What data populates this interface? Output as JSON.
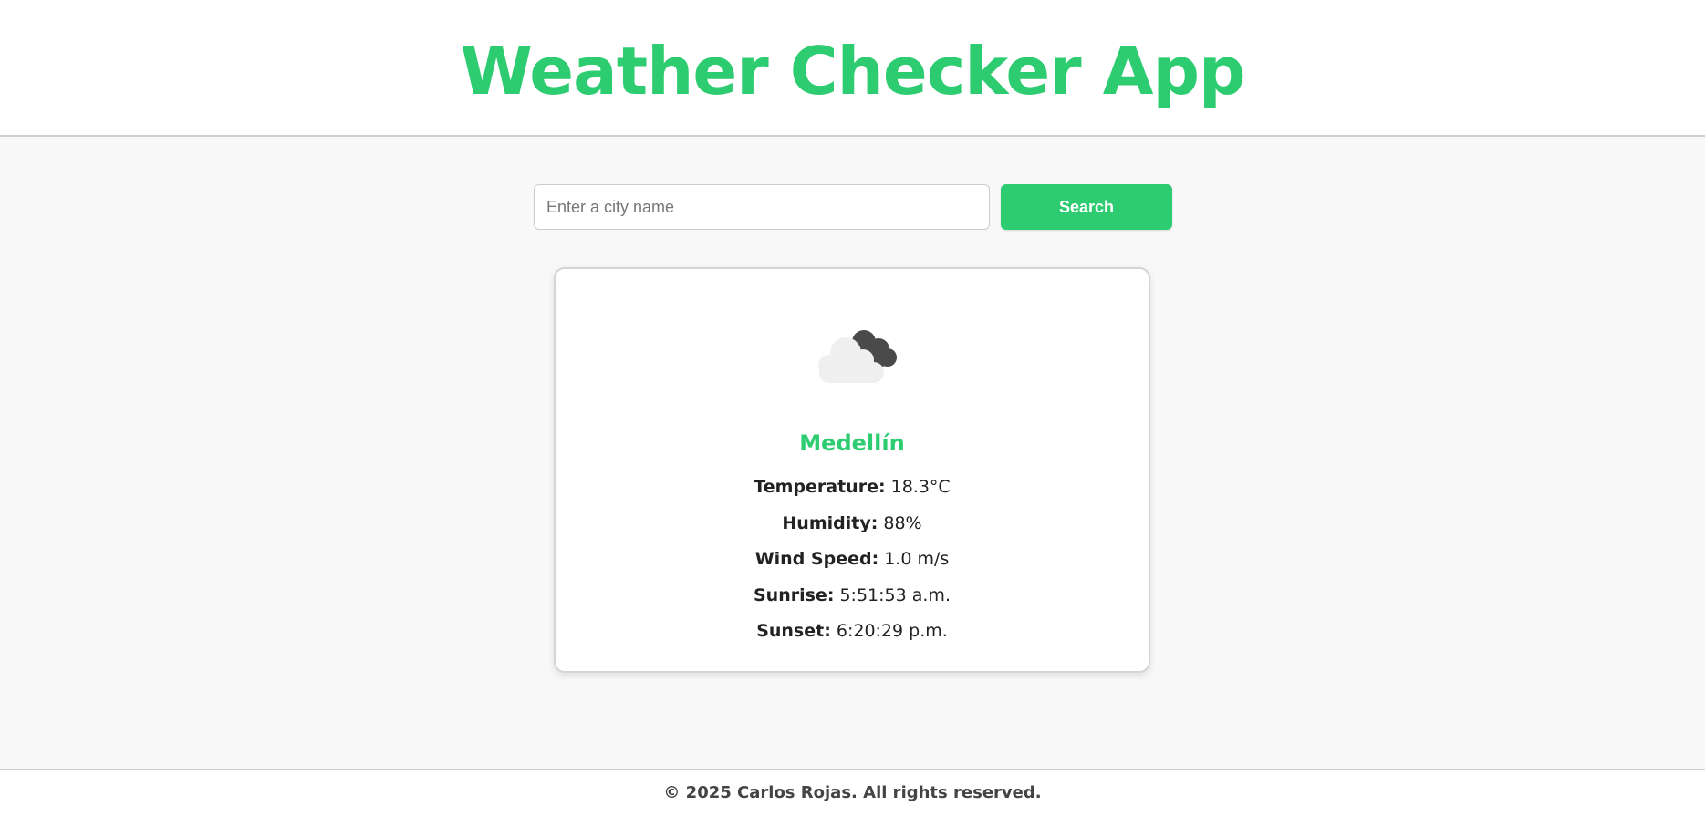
{
  "colors": {
    "accent": "#2ecc71",
    "background": "#f8f8f8",
    "card": "#ffffff",
    "text": "#222222",
    "cloud_light": "#efefef",
    "cloud_dark": "#4a4a4a"
  },
  "header": {
    "title": "Weather Checker App"
  },
  "search": {
    "placeholder": "Enter a city name",
    "value": "",
    "button_label": "Search"
  },
  "weather": {
    "icon": "partly-cloudy-icon",
    "city": "Medellín",
    "details": [
      {
        "label": "Temperature:",
        "value": "18.3°C"
      },
      {
        "label": "Humidity:",
        "value": "88%"
      },
      {
        "label": "Wind Speed:",
        "value": "1.0 m/s"
      },
      {
        "label": "Sunrise:",
        "value": "5:51:53 a.m."
      },
      {
        "label": "Sunset:",
        "value": "6:20:29 p.m."
      }
    ]
  },
  "footer": {
    "text": "© 2025 Carlos Rojas. All rights reserved."
  }
}
